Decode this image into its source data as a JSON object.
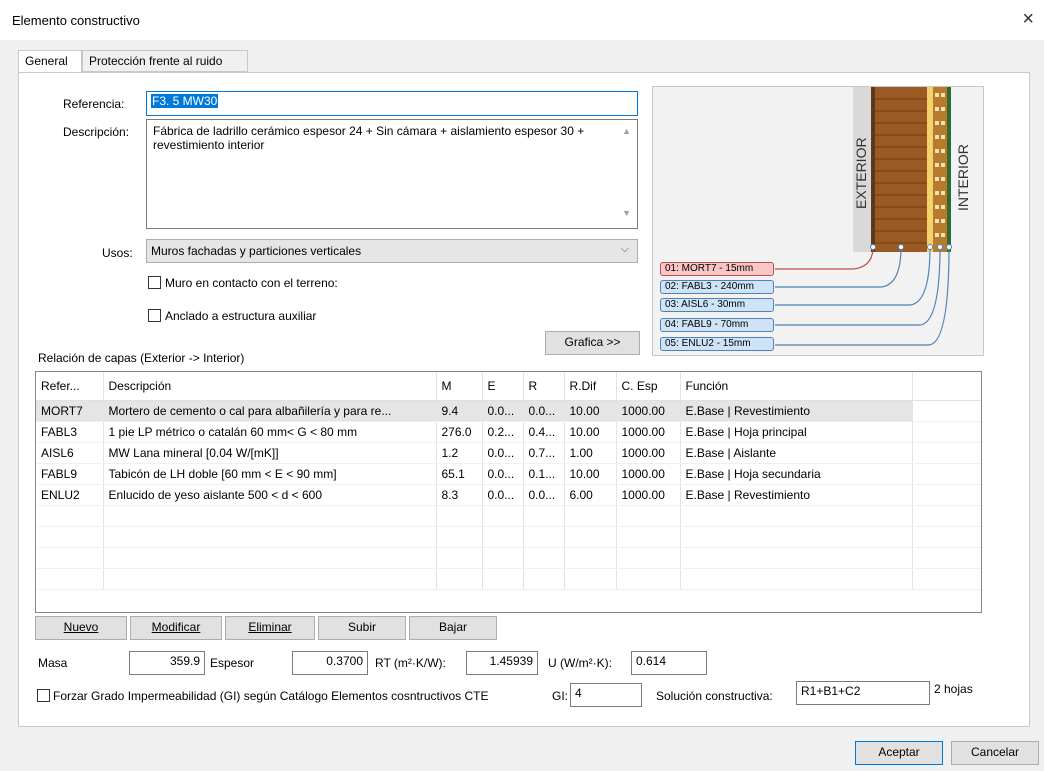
{
  "window": {
    "title": "Elemento constructivo",
    "close": "×"
  },
  "tabs": [
    {
      "label": "General"
    },
    {
      "label": "Protección frente al ruido"
    }
  ],
  "form": {
    "referencia_label": "Referencia:",
    "referencia_value": "F3. 5 MW30",
    "descripcion_label": "Descripción:",
    "descripcion_value": "Fábrica de ladrillo cerámico espesor 24 + Sin cámara + aislamiento espesor 30 + revestimiento interior",
    "usos_label": "Usos:",
    "usos_value": "Muros fachadas y particiones verticales",
    "chk_terreno_label": "Muro en contacto con el terreno:",
    "chk_anclado_label": "Anclado a estructura auxiliar",
    "grafica_button": "Grafica >>"
  },
  "diagram": {
    "exterior": "EXTERIOR",
    "interior": "INTERIOR",
    "layer_tags": [
      "01: MORT7 - 15mm",
      "02: FABL3 - 240mm",
      "03: AISL6 - 30mm",
      "04: FABL9 - 70mm",
      "05: ENLU2 - 15mm"
    ]
  },
  "layers_caption": "Relación de capas (Exterior -> Interior)",
  "table": {
    "headers": [
      "Refer...",
      "Descripción",
      "M",
      "E",
      "R",
      "R.Dif",
      "C. Esp",
      "Función"
    ],
    "rows": [
      [
        "MORT7",
        "Mortero de cemento o cal para albañilería y para re...",
        "9.4",
        "0.0...",
        "0.0...",
        "10.00",
        "1000.00",
        "E.Base | Revestimiento"
      ],
      [
        "FABL3",
        "1 pie LP métrico o catalán 60 mm< G < 80 mm",
        "276.0",
        "0.2...",
        "0.4...",
        "10.00",
        "1000.00",
        "E.Base | Hoja principal"
      ],
      [
        "AISL6",
        "MW Lana mineral [0.04 W/[mK]]",
        "1.2",
        "0.0...",
        "0.7...",
        "1.00",
        "1000.00",
        "E.Base | Aislante"
      ],
      [
        "FABL9",
        "Tabicón de LH doble [60 mm < E < 90 mm]",
        "65.1",
        "0.0...",
        "0.1...",
        "10.00",
        "1000.00",
        "E.Base | Hoja secundaria"
      ],
      [
        "ENLU2",
        "Enlucido de yeso aislante 500 < d < 600",
        "8.3",
        "0.0...",
        "0.0...",
        "6.00",
        "1000.00",
        "E.Base | Revestimiento"
      ]
    ]
  },
  "row_buttons": [
    "Nuevo",
    "Modificar",
    "Eliminar",
    "Subir",
    "Bajar"
  ],
  "summary": {
    "masa_label": "Masa",
    "masa_value": "359.9",
    "espesor_label": "Espesor",
    "espesor_value": "0.3700",
    "rt_label": "RT (m²·K/W):",
    "rt_value": "1.45939",
    "u_label": "U (W/m²·K):",
    "u_value": "0.614"
  },
  "gi": {
    "forzar_label": "Forzar Grado Impermeabilidad (GI) según Catálogo Elementos cosntructivos CTE",
    "gi_label": "GI:",
    "gi_value": "4",
    "solucion_label": "Solución constructiva:",
    "solucion_value": "R1+B1+C2",
    "hojas": "2 hojas"
  },
  "footer": {
    "aceptar": "Aceptar",
    "cancelar": "Cancelar"
  }
}
